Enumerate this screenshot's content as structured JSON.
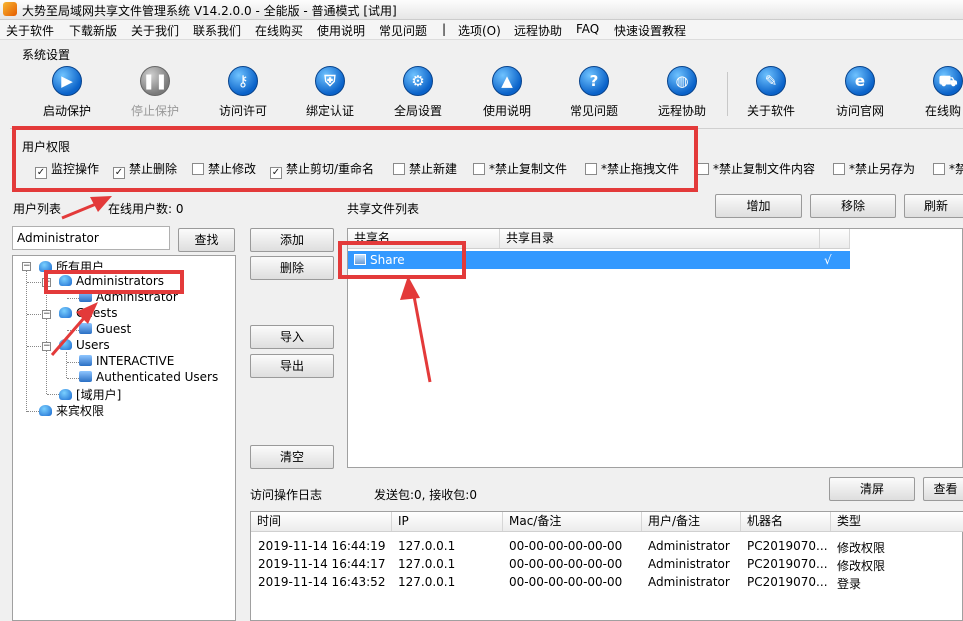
{
  "window": {
    "title": "大势至局域网共享文件管理系统 V14.2.0.0 - 全能版 - 普通模式 [试用]"
  },
  "menu": [
    "关于软件",
    "下载新版",
    "关于我们",
    "联系我们",
    "在线购买",
    "使用说明",
    "常见问题",
    "|",
    "选项(O)",
    "远程协助",
    "FAQ",
    "快速设置教程"
  ],
  "toolbar": {
    "group_label": "系统设置",
    "buttons": [
      {
        "label": "启动保护",
        "icon": "play-icon",
        "enabled": true
      },
      {
        "label": "停止保护",
        "icon": "pause-icon",
        "enabled": false
      },
      {
        "label": "访问许可",
        "icon": "key-icon",
        "enabled": true
      },
      {
        "label": "绑定认证",
        "icon": "shield-icon",
        "enabled": true
      },
      {
        "label": "全局设置",
        "icon": "gear-icon",
        "enabled": true
      },
      {
        "label": "使用说明",
        "icon": "graduation-cap-icon",
        "enabled": true
      },
      {
        "label": "常见问题",
        "icon": "question-icon",
        "enabled": true
      },
      {
        "label": "远程协助",
        "icon": "globe-icon",
        "enabled": true
      },
      {
        "label": "关于软件",
        "icon": "document-icon",
        "enabled": true
      },
      {
        "label": "访问官网",
        "icon": "ie-icon",
        "enabled": true
      },
      {
        "label": "在线购",
        "icon": "cart-icon",
        "enabled": true
      }
    ]
  },
  "permissions": {
    "label": "用户权限",
    "items": [
      {
        "label": "监控操作",
        "checked": true
      },
      {
        "label": "禁止删除",
        "checked": true
      },
      {
        "label": "禁止修改",
        "checked": false
      },
      {
        "label": "禁止剪切/重命名",
        "checked": true
      },
      {
        "label": "禁止新建",
        "checked": false
      },
      {
        "label": "*禁止复制文件",
        "checked": false
      },
      {
        "label": "*禁止拖拽文件",
        "checked": false
      },
      {
        "label": "*禁止复制文件内容",
        "checked": false
      },
      {
        "label": "*禁止另存为",
        "checked": false
      },
      {
        "label": "*禁",
        "checked": false
      }
    ]
  },
  "users": {
    "list_label": "用户列表",
    "online_label": "在线用户数: 0",
    "search_value": "Administrator",
    "search_button": "查找",
    "tree": {
      "all_users": "所有用户",
      "administrators": "Administrators",
      "administrator": "Administrator",
      "guests": "Guests",
      "guest": "Guest",
      "users": "Users",
      "interactive": "INTERACTIVE",
      "authenticated": "Authenticated Users",
      "domain_users": "[域用户]",
      "guest_perm": "来宾权限"
    }
  },
  "middle_buttons": {
    "add": "添加",
    "delete": "删除",
    "import": "导入",
    "export": "导出",
    "clear": "清空"
  },
  "shares": {
    "label": "共享文件列表",
    "add_button": "增加",
    "remove_button": "移除",
    "refresh_button": "刷新",
    "columns": [
      "共享名",
      "共享目录"
    ],
    "rows": [
      {
        "name": "Share",
        "dir": "",
        "check": "√"
      }
    ]
  },
  "log": {
    "label": "访问操作日志",
    "stats": "发送包:0, 接收包:0",
    "clear_button": "清屏",
    "view_button": "查看",
    "columns": [
      "时间",
      "IP",
      "Mac/备注",
      "用户/备注",
      "机器名",
      "类型"
    ],
    "rows": [
      {
        "time": "2019-11-14 16:44:19",
        "ip": "127.0.0.1",
        "mac": "00-00-00-00-00-00",
        "user": "Administrator",
        "machine": "PC2019070...",
        "type": "修改权限"
      },
      {
        "time": "2019-11-14 16:44:17",
        "ip": "127.0.0.1",
        "mac": "00-00-00-00-00-00",
        "user": "Administrator",
        "machine": "PC2019070...",
        "type": "修改权限"
      },
      {
        "time": "2019-11-14 16:43:52",
        "ip": "127.0.0.1",
        "mac": "00-00-00-00-00-00",
        "user": "Administrator",
        "machine": "PC2019070...",
        "type": "登录"
      }
    ]
  },
  "colors": {
    "annotation_red": "#e33a3a",
    "selection_blue": "#3399ff",
    "icon_blue": "#0a62c9"
  }
}
